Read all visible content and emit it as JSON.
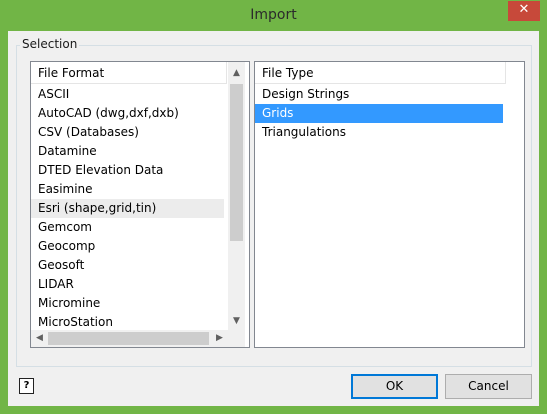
{
  "window": {
    "title": "Import",
    "close_glyph": "✕"
  },
  "group": {
    "label": "Selection"
  },
  "file_format": {
    "header": "File Format",
    "items": [
      "ASCII",
      "AutoCAD (dwg,dxf,dxb)",
      "CSV (Databases)",
      "Datamine",
      "DTED Elevation Data",
      "Easimine",
      "Esri (shape,grid,tin)",
      "Gemcom",
      "Geocomp",
      "Geosoft",
      "LIDAR",
      "Micromine",
      "MicroStation"
    ],
    "highlighted": "Esri (shape,grid,tin)",
    "scroll_up_glyph": "▲",
    "scroll_down_glyph": "▼",
    "scroll_left_glyph": "◀",
    "scroll_right_glyph": "▶"
  },
  "file_type": {
    "header": "File Type",
    "items": [
      "Design Strings",
      "Grids",
      "Triangulations"
    ],
    "selected": "Grids"
  },
  "help": {
    "glyph": "?"
  },
  "buttons": {
    "ok": "OK",
    "cancel": "Cancel"
  },
  "colors": {
    "title_bar": "#71b546",
    "selection": "#3399ff",
    "close": "#c7493a"
  }
}
